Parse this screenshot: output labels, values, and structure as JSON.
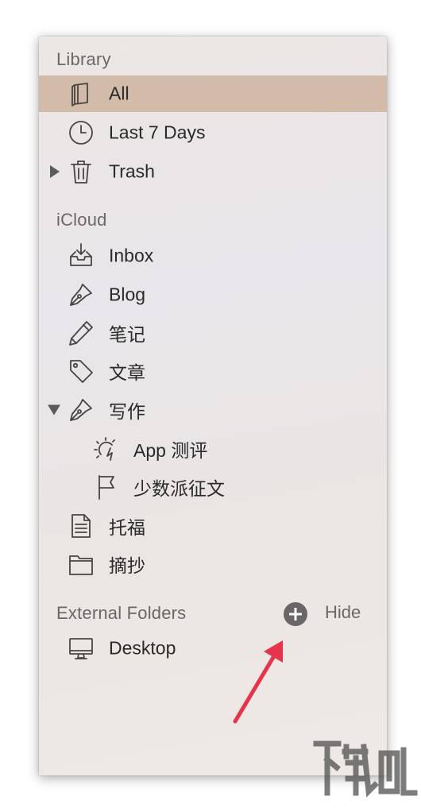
{
  "library": {
    "header": "Library",
    "items": [
      {
        "label": "All",
        "icon": "book-icon",
        "selected": true
      },
      {
        "label": "Last 7 Days",
        "icon": "clock-icon"
      },
      {
        "label": "Trash",
        "icon": "trash-icon"
      }
    ]
  },
  "icloud": {
    "header": "iCloud",
    "items": [
      {
        "label": "Inbox",
        "icon": "inbox-tray-icon"
      },
      {
        "label": "Blog",
        "icon": "pen-nib-icon"
      },
      {
        "label": "笔记",
        "icon": "pencil-icon"
      },
      {
        "label": "文章",
        "icon": "tag-icon"
      },
      {
        "label": "写作",
        "icon": "pen-nib-icon"
      },
      {
        "label": "App 测评",
        "icon": "sun-spark-icon"
      },
      {
        "label": "少数派征文",
        "icon": "flag-icon"
      },
      {
        "label": "托福",
        "icon": "document-icon"
      },
      {
        "label": "摘抄",
        "icon": "folder-icon"
      }
    ]
  },
  "external": {
    "header": "External Folders",
    "add_icon": "plus-circle-icon",
    "hide_label": "Hide",
    "items": [
      {
        "label": "Desktop",
        "icon": "monitor-icon"
      }
    ]
  },
  "colors": {
    "selection": "#d3bba9",
    "arrow": "#e8344a",
    "header_text": "#6b6766"
  }
}
